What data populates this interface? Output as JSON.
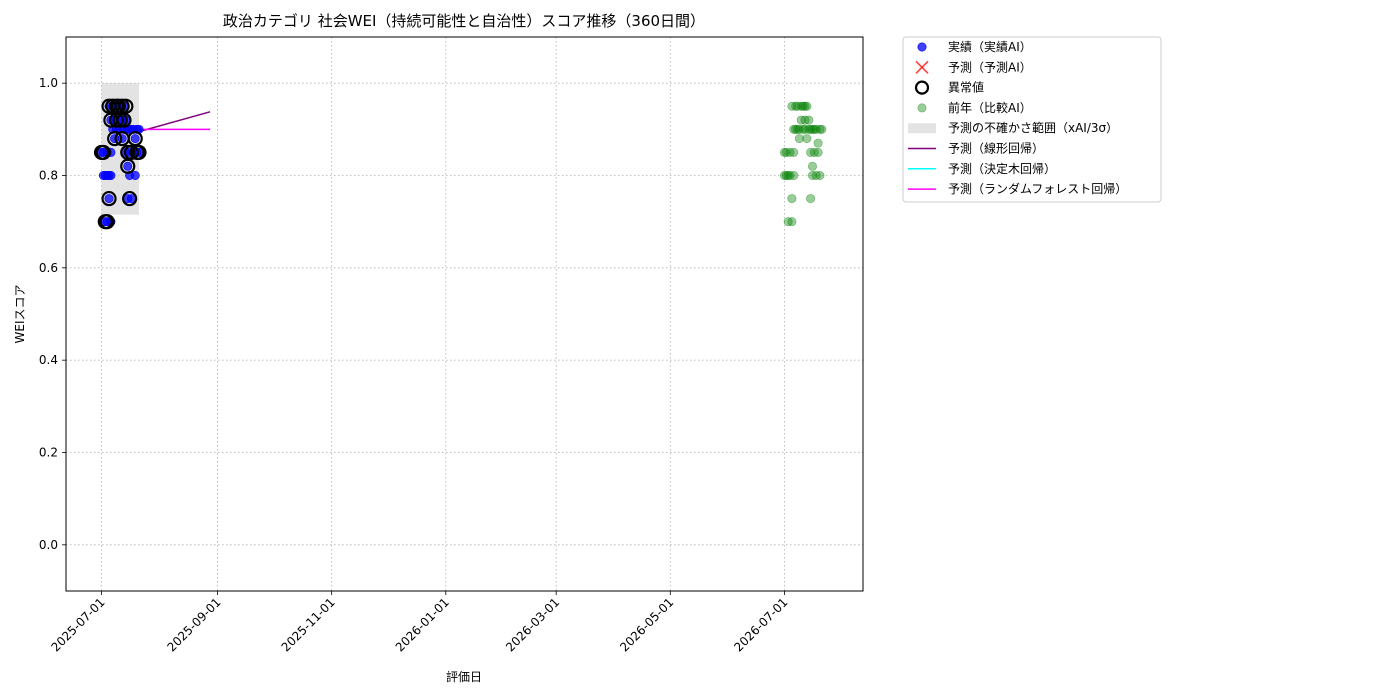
{
  "chart_data": {
    "type": "scatter",
    "title": "政治カテゴリ 社会WEI（持続可能性と自治性）スコア推移（360日間）",
    "xlabel": "評価日",
    "ylabel": "WEIスコア",
    "ylim": [
      -0.1,
      1.1
    ],
    "xlim": [
      "2025-06-12",
      "2026-08-12"
    ],
    "x_ticks": [
      "2025-07-01",
      "2025-09-01",
      "2025-11-01",
      "2026-01-01",
      "2026-03-01",
      "2026-05-01",
      "2026-07-01"
    ],
    "y_ticks": [
      "0.0",
      "0.2",
      "0.4",
      "0.6",
      "0.8",
      "1.0"
    ],
    "grid": true,
    "legend_position": "outside-top-right",
    "colors": {
      "actual": "#0000ff",
      "forecast": "#ff0000",
      "anomaly": "#000000",
      "previous": "#008000",
      "uncertainty": "#cccccc",
      "linear": "#800080",
      "tree": "#00ffff",
      "forest": "#ff00ff"
    },
    "legend": [
      {
        "key": "actual",
        "label": "実績（実績AI）"
      },
      {
        "key": "forecast",
        "label": "予測（予測AI）"
      },
      {
        "key": "anomaly",
        "label": "異常値"
      },
      {
        "key": "previous",
        "label": "前年（比較AI）"
      },
      {
        "key": "uncertainty",
        "label": "予測の不確かさ範囲（xAI/3σ）"
      },
      {
        "key": "linear",
        "label": "予測（線形回帰）"
      },
      {
        "key": "tree",
        "label": "予測（決定木回帰）"
      },
      {
        "key": "forest",
        "label": "予測（ランダムフォレスト回帰）"
      }
    ],
    "series": [
      {
        "name": "実績（実績AI）",
        "marker": "circle",
        "points": [
          [
            "2025-07-01",
            0.85
          ],
          [
            "2025-07-02",
            0.85
          ],
          [
            "2025-07-02",
            0.8
          ],
          [
            "2025-07-03",
            0.8
          ],
          [
            "2025-07-03",
            0.7
          ],
          [
            "2025-07-04",
            0.85
          ],
          [
            "2025-07-04",
            0.8
          ],
          [
            "2025-07-04",
            0.7
          ],
          [
            "2025-07-05",
            0.95
          ],
          [
            "2025-07-05",
            0.75
          ],
          [
            "2025-07-05",
            0.8
          ],
          [
            "2025-07-06",
            0.92
          ],
          [
            "2025-07-06",
            0.85
          ],
          [
            "2025-07-06",
            0.8
          ],
          [
            "2025-07-06",
            0.7
          ],
          [
            "2025-07-07",
            0.95
          ],
          [
            "2025-07-07",
            0.9
          ],
          [
            "2025-07-08",
            0.95
          ],
          [
            "2025-07-08",
            0.92
          ],
          [
            "2025-07-08",
            0.88
          ],
          [
            "2025-07-09",
            0.95
          ],
          [
            "2025-07-09",
            0.9
          ],
          [
            "2025-07-10",
            0.92
          ],
          [
            "2025-07-10",
            0.95
          ],
          [
            "2025-07-11",
            0.95
          ],
          [
            "2025-07-11",
            0.9
          ],
          [
            "2025-07-12",
            0.92
          ],
          [
            "2025-07-12",
            0.88
          ],
          [
            "2025-07-13",
            0.95
          ],
          [
            "2025-07-13",
            0.9
          ],
          [
            "2025-07-14",
            0.92
          ],
          [
            "2025-07-14",
            0.85
          ],
          [
            "2025-07-15",
            0.9
          ],
          [
            "2025-07-15",
            0.82
          ],
          [
            "2025-07-15",
            0.75
          ],
          [
            "2025-07-16",
            0.9
          ],
          [
            "2025-07-16",
            0.85
          ],
          [
            "2025-07-16",
            0.8
          ],
          [
            "2025-07-17",
            0.9
          ],
          [
            "2025-07-17",
            0.75
          ],
          [
            "2025-07-18",
            0.85
          ],
          [
            "2025-07-18",
            0.9
          ],
          [
            "2025-07-19",
            0.8
          ],
          [
            "2025-07-19",
            0.88
          ],
          [
            "2025-07-20",
            0.9
          ],
          [
            "2025-07-20",
            0.85
          ],
          [
            "2025-07-21",
            0.9
          ],
          [
            "2025-07-21",
            0.85
          ]
        ]
      },
      {
        "name": "異常値",
        "marker": "ring",
        "points": [
          [
            "2025-07-01",
            0.85
          ],
          [
            "2025-07-02",
            0.85
          ],
          [
            "2025-07-03",
            0.7
          ],
          [
            "2025-07-04",
            0.7
          ],
          [
            "2025-07-05",
            0.75
          ],
          [
            "2025-07-05",
            0.95
          ],
          [
            "2025-07-06",
            0.92
          ],
          [
            "2025-07-07",
            0.95
          ],
          [
            "2025-07-08",
            0.88
          ],
          [
            "2025-07-09",
            0.95
          ],
          [
            "2025-07-09",
            0.92
          ],
          [
            "2025-07-10",
            0.95
          ],
          [
            "2025-07-11",
            0.92
          ],
          [
            "2025-07-12",
            0.95
          ],
          [
            "2025-07-12",
            0.88
          ],
          [
            "2025-07-13",
            0.92
          ],
          [
            "2025-07-14",
            0.95
          ],
          [
            "2025-07-15",
            0.82
          ],
          [
            "2025-07-15",
            0.85
          ],
          [
            "2025-07-16",
            0.75
          ],
          [
            "2025-07-17",
            0.85
          ],
          [
            "2025-07-19",
            0.88
          ],
          [
            "2025-07-20",
            0.85
          ],
          [
            "2025-07-21",
            0.85
          ]
        ]
      },
      {
        "name": "前年（比較AI）",
        "marker": "circle",
        "points": [
          [
            "2026-07-01",
            0.85
          ],
          [
            "2026-07-01",
            0.8
          ],
          [
            "2026-07-02",
            0.8
          ],
          [
            "2026-07-02",
            0.85
          ],
          [
            "2026-07-03",
            0.8
          ],
          [
            "2026-07-03",
            0.7
          ],
          [
            "2026-07-04",
            0.8
          ],
          [
            "2026-07-04",
            0.85
          ],
          [
            "2026-07-05",
            0.75
          ],
          [
            "2026-07-05",
            0.95
          ],
          [
            "2026-07-05",
            0.7
          ],
          [
            "2026-07-06",
            0.9
          ],
          [
            "2026-07-06",
            0.8
          ],
          [
            "2026-07-06",
            0.85
          ],
          [
            "2026-07-07",
            0.95
          ],
          [
            "2026-07-07",
            0.9
          ],
          [
            "2026-07-08",
            0.9
          ],
          [
            "2026-07-08",
            0.95
          ],
          [
            "2026-07-09",
            0.88
          ],
          [
            "2026-07-09",
            0.9
          ],
          [
            "2026-07-10",
            0.92
          ],
          [
            "2026-07-10",
            0.95
          ],
          [
            "2026-07-11",
            0.9
          ],
          [
            "2026-07-11",
            0.95
          ],
          [
            "2026-07-12",
            0.95
          ],
          [
            "2026-07-12",
            0.92
          ],
          [
            "2026-07-12",
            0.9
          ],
          [
            "2026-07-13",
            0.88
          ],
          [
            "2026-07-13",
            0.95
          ],
          [
            "2026-07-14",
            0.92
          ],
          [
            "2026-07-14",
            0.9
          ],
          [
            "2026-07-15",
            0.9
          ],
          [
            "2026-07-15",
            0.85
          ],
          [
            "2026-07-15",
            0.75
          ],
          [
            "2026-07-16",
            0.82
          ],
          [
            "2026-07-16",
            0.8
          ],
          [
            "2026-07-16",
            0.9
          ],
          [
            "2026-07-17",
            0.85
          ],
          [
            "2026-07-17",
            0.9
          ],
          [
            "2026-07-18",
            0.8
          ],
          [
            "2026-07-18",
            0.9
          ],
          [
            "2026-07-19",
            0.87
          ],
          [
            "2026-07-19",
            0.85
          ],
          [
            "2026-07-20",
            0.9
          ],
          [
            "2026-07-20",
            0.8
          ],
          [
            "2026-07-21",
            0.9
          ]
        ]
      }
    ],
    "uncertainty_band": {
      "x_start": "2025-07-01",
      "x_end": "2025-07-21",
      "y_low": 0.715,
      "y_high": 1.0
    },
    "forecast_lines": [
      {
        "name": "予測（線形回帰）",
        "points": [
          [
            "2025-07-21",
            0.895
          ],
          [
            "2025-08-28",
            0.938
          ]
        ]
      },
      {
        "name": "予測（ランダムフォレスト回帰）",
        "points": [
          [
            "2025-07-21",
            0.9
          ],
          [
            "2025-08-28",
            0.9
          ]
        ]
      }
    ]
  }
}
